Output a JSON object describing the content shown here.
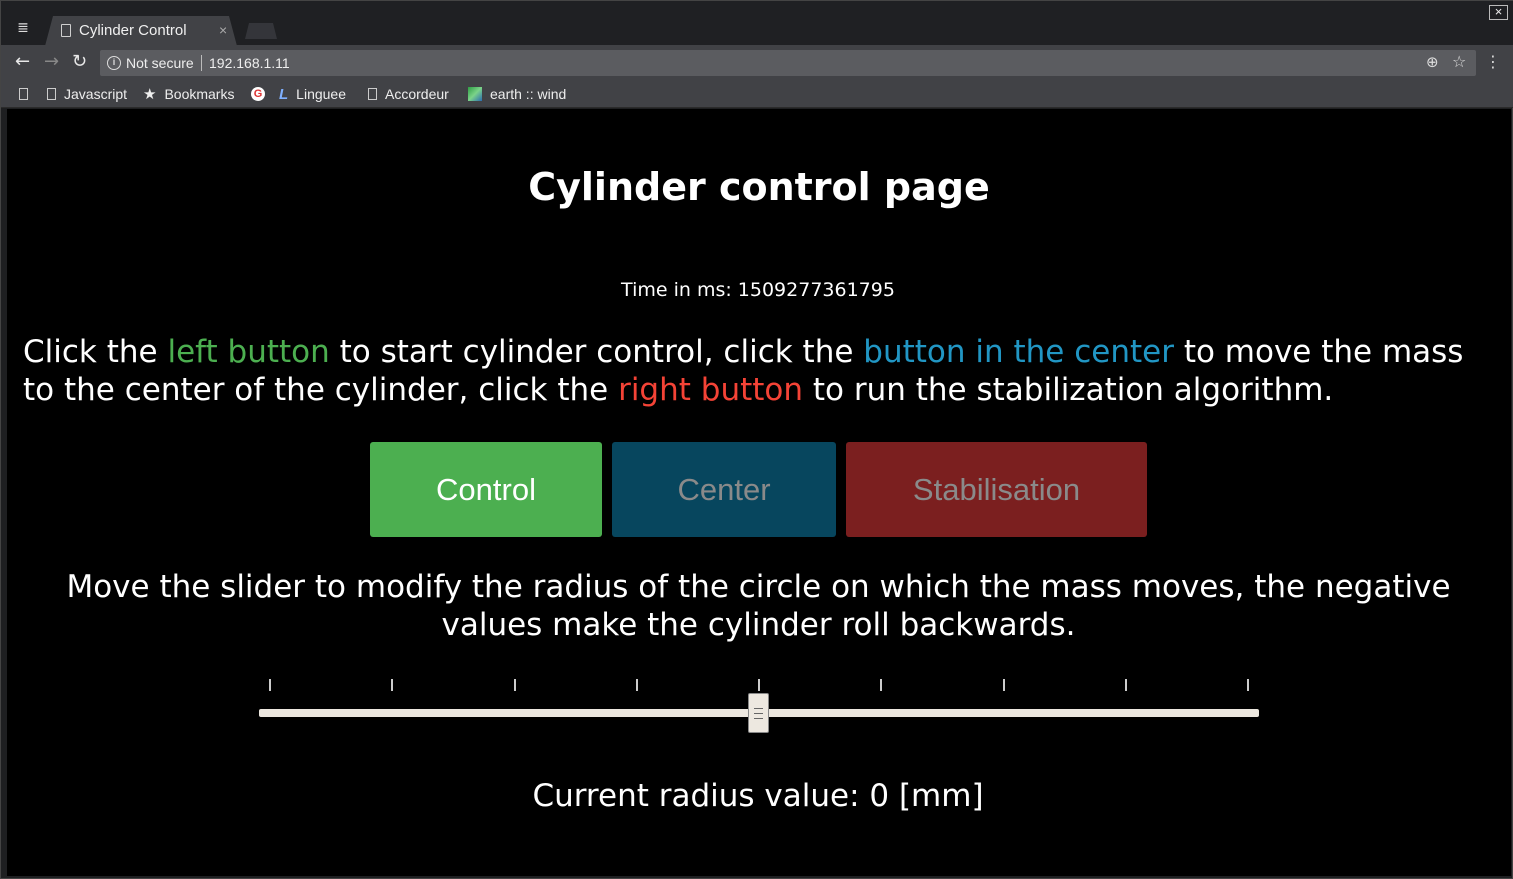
{
  "browser": {
    "tab_title": "Cylinder Control",
    "tab_close": "×",
    "window_close": "×",
    "security_label": "Not secure",
    "url": "192.168.1.11",
    "bookmarks": [
      {
        "label": "Javascript",
        "icon": "page-icon"
      },
      {
        "label": "Bookmarks",
        "icon": "star-icon"
      },
      {
        "label": "",
        "icon": "google-icon"
      },
      {
        "label": "Linguee",
        "icon": "linguee-icon"
      },
      {
        "label": "Accordeur",
        "icon": "page-icon"
      },
      {
        "label": "earth :: wind",
        "icon": "earth-icon"
      }
    ]
  },
  "page": {
    "title": "Cylinder control page",
    "time_label": "Time in ms: 1509277361795",
    "instructions": {
      "part1": "Click the ",
      "left": "left button",
      "part2": " to start cylinder control, click the ",
      "center": "button in the center",
      "part3": " to move the mass to the center of the cylinder, click the ",
      "right": "right button",
      "part4": " to run the stabilization algorithm."
    },
    "buttons": {
      "control": "Control",
      "center": "Center",
      "stabilisation": "Stabilisation"
    },
    "slider_description": "Move the slider to modify the radius of the circle on which the mass moves, the negative values make the cylinder roll backwards.",
    "slider_value": 0,
    "radius_label": "Current radius value: 0 [mm]"
  },
  "colors": {
    "left_text": "#4caf50",
    "center_text": "#2196c4",
    "right_text": "#f44336",
    "control_btn": "#4caf50",
    "center_btn": "#07465e",
    "stab_btn": "#7b1f1f"
  }
}
